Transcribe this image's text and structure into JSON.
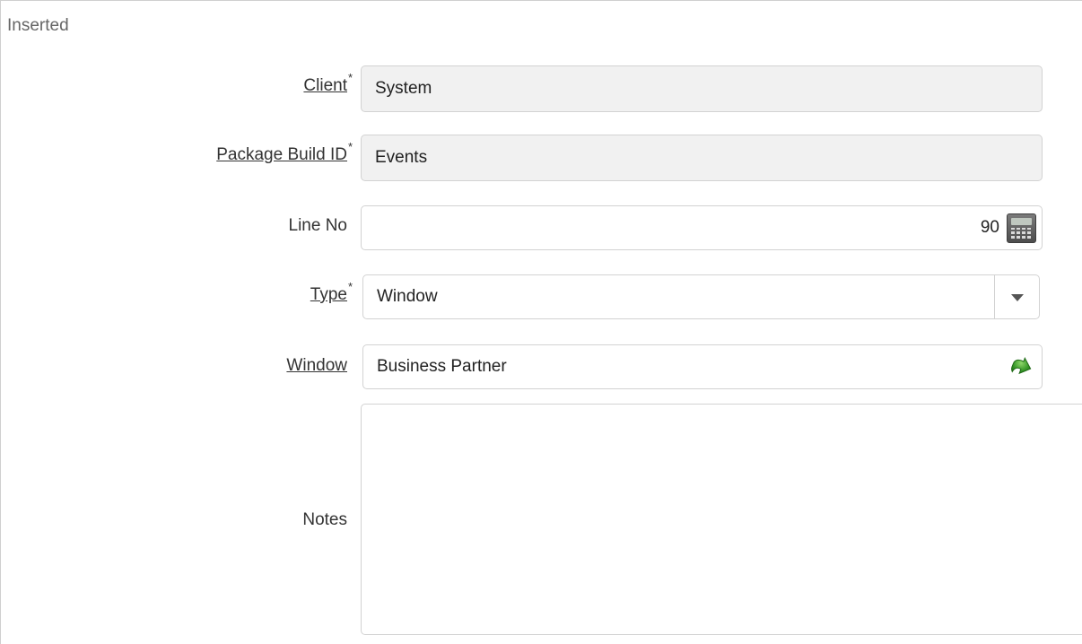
{
  "form": {
    "status": "Inserted",
    "fields": {
      "client": {
        "label": "Client",
        "required_mark": "*",
        "value": "System"
      },
      "package_build_id": {
        "label": "Package Build ID",
        "required_mark": "*",
        "value": "Events"
      },
      "line_no": {
        "label": "Line No",
        "value": "90",
        "icon": "calculator-icon"
      },
      "type": {
        "label": "Type",
        "required_mark": "*",
        "value": "Window",
        "icon": "chevron-down-icon"
      },
      "window": {
        "label": "Window",
        "value": "Business Partner",
        "icon": "zoom-arrow-icon"
      },
      "notes": {
        "label": "Notes",
        "value": ""
      }
    }
  },
  "colors": {
    "readonly_bg": "#f1f1f1",
    "border": "#d2d2d2",
    "zoom_green": "#3a9a2a"
  }
}
